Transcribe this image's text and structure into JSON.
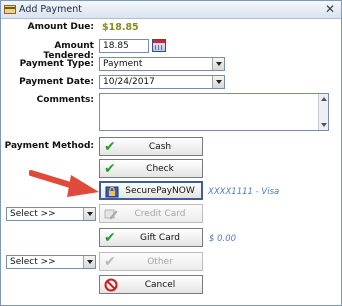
{
  "window": {
    "title": "Add Payment",
    "close_glyph": "✕"
  },
  "labels": {
    "amount_due": "Amount Due:",
    "amount_tendered": "Amount Tendered:",
    "payment_type": "Payment Type:",
    "payment_date": "Payment Date:",
    "comments": "Comments:",
    "payment_method": "Payment Method:"
  },
  "values": {
    "amount_due": "$18.85",
    "amount_tendered": "18.85",
    "payment_type": "Payment",
    "payment_date": "10/24/2017"
  },
  "buttons": {
    "cash": "Cash",
    "check": "Check",
    "securepay": "SecurePayNOW",
    "credit_card": "Credit Card",
    "gift_card": "Gift Card",
    "other": "Other",
    "cancel": "Cancel"
  },
  "selects": {
    "credit_card_select": "Select >>",
    "other_select": "Select >>"
  },
  "notes": {
    "card_on_file": "XXXX1111 - Visa",
    "gift_card_balance": "$ 0.00"
  },
  "colors": {
    "amount_due": "#8a8a1e",
    "check_green": "#2e9a2e",
    "arrow_red": "#e04a3a",
    "note_blue": "#4f7bb5"
  },
  "icons": {
    "window": "add-payment-icon",
    "calendar": "calendar-icon",
    "check": "checkmark-icon",
    "lock": "securepay-lock-icon",
    "credit_card": "credit-card-pencil-icon",
    "cancel": "prohibited-icon"
  }
}
